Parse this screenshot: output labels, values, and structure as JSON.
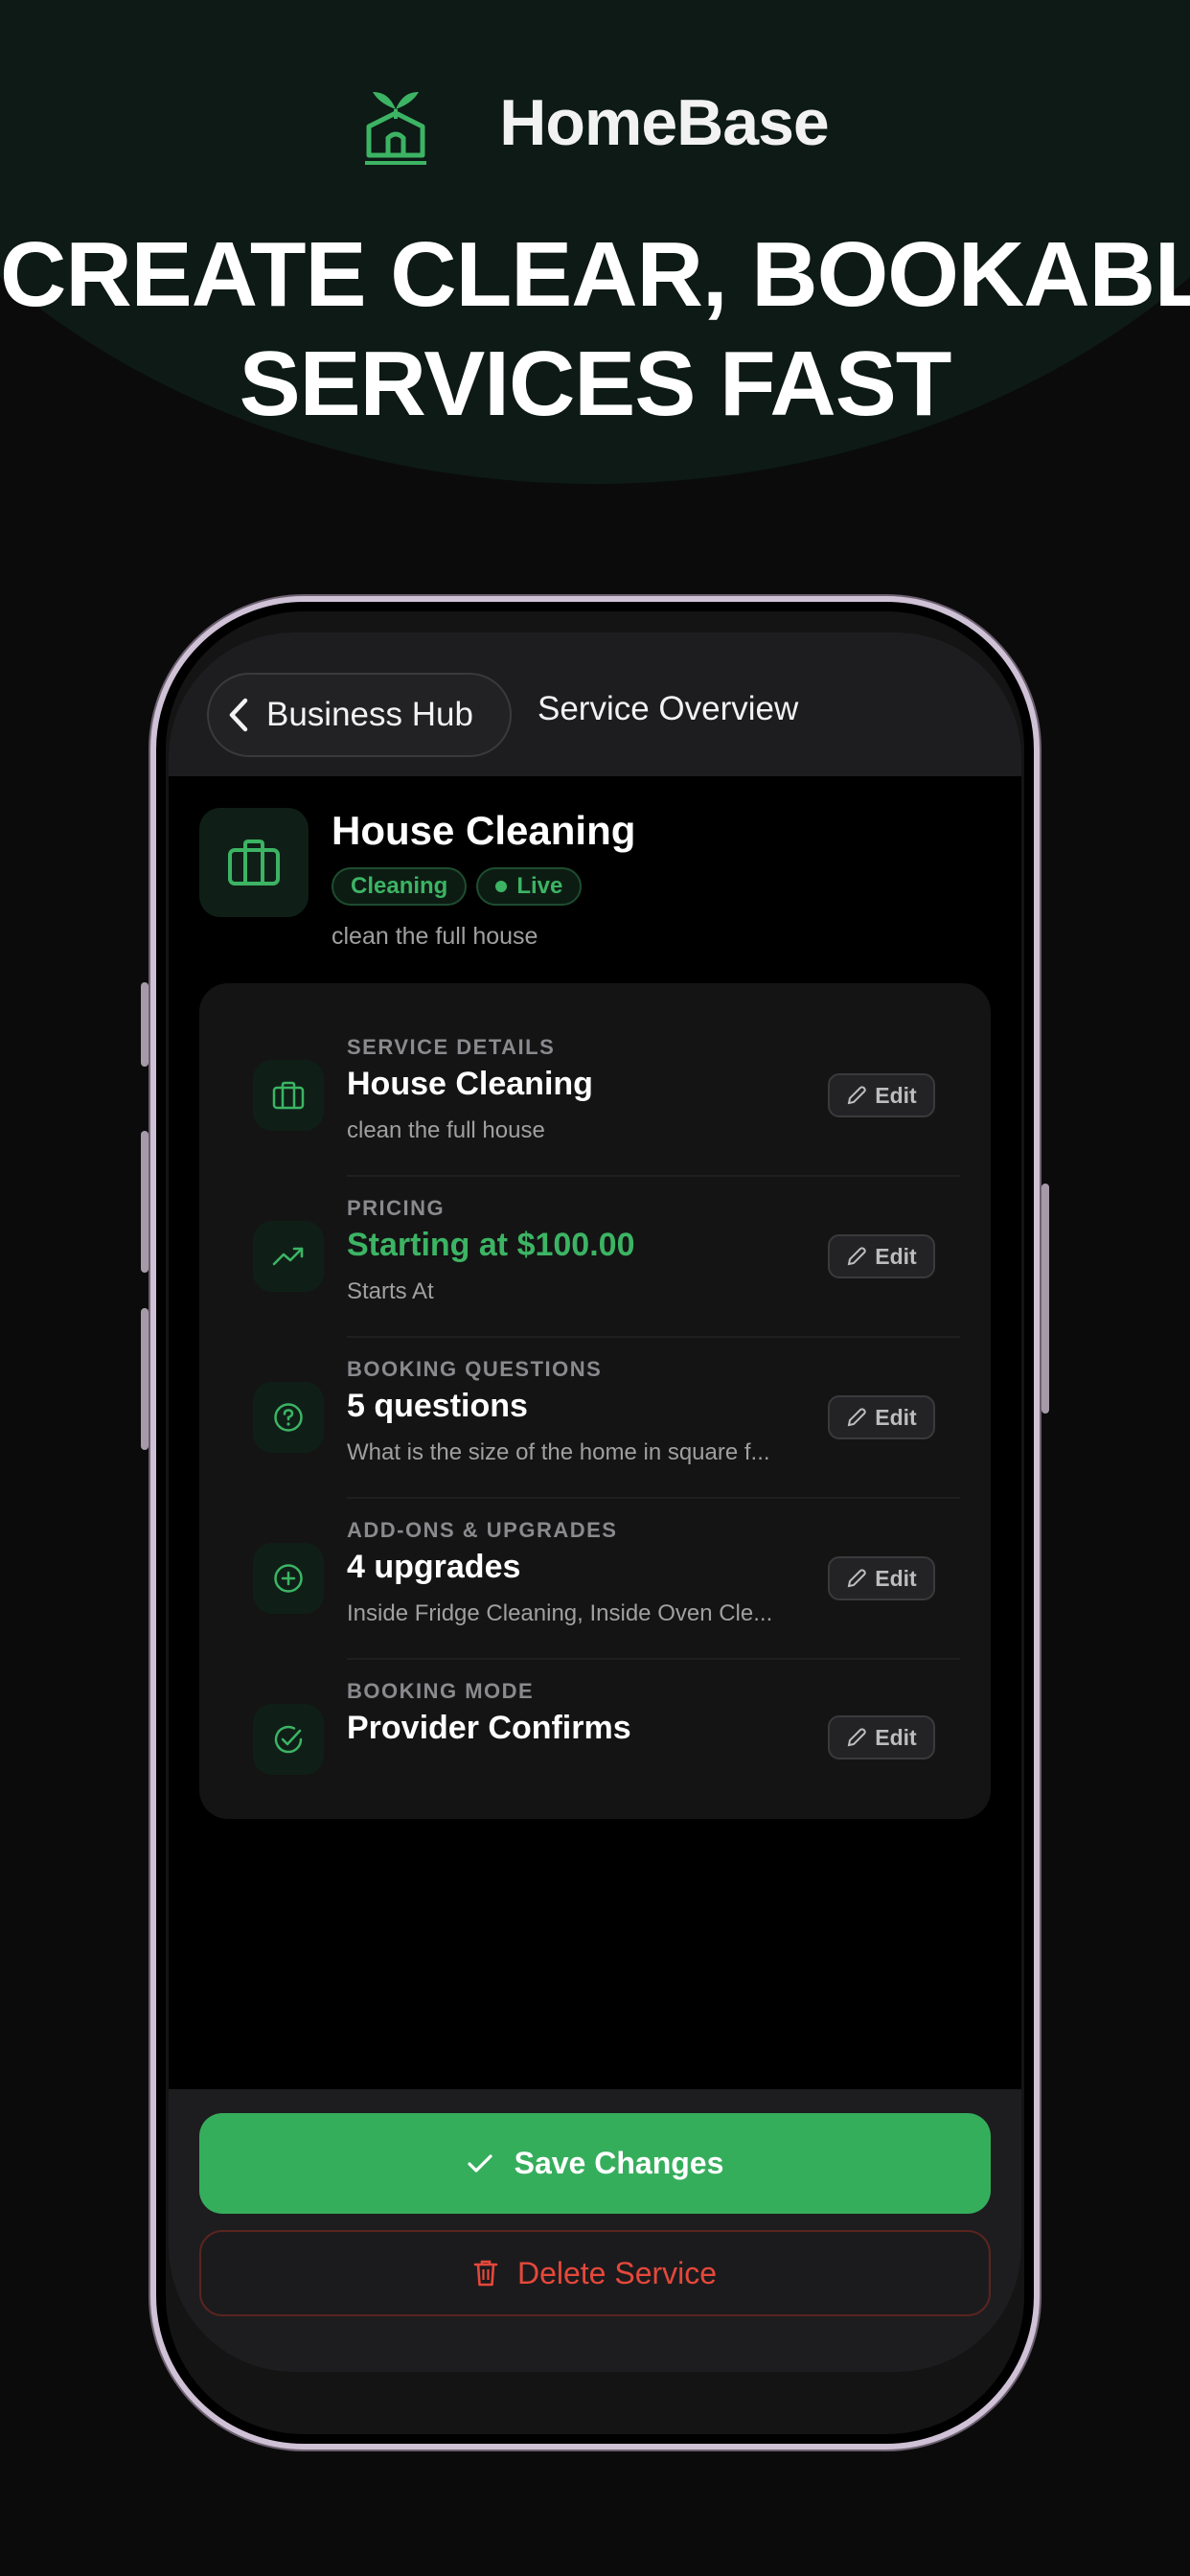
{
  "brand": {
    "name": "HomeBase",
    "logo": "house-sprout-logo"
  },
  "headline": {
    "line1": "CREATE CLEAR, BOOKABLE",
    "line2": "SERVICES FAST"
  },
  "nav": {
    "back_label": "Business Hub",
    "title": "Service Overview",
    "back_icon": "chevron-left-icon"
  },
  "service": {
    "title": "House Cleaning",
    "badges": [
      "Cleaning",
      "Live"
    ],
    "subtitle": "clean the full house",
    "icon": "briefcase-icon"
  },
  "sections": [
    {
      "eyebrow": "SERVICE DETAILS",
      "main": "House Cleaning",
      "sub": "clean the full house",
      "icon": "briefcase-icon",
      "edit": "Edit"
    },
    {
      "eyebrow": "PRICING",
      "main": "Starting at $100.00",
      "sub": "Starts At",
      "icon": "trending-up-icon",
      "edit": "Edit"
    },
    {
      "eyebrow": "BOOKING QUESTIONS",
      "main": "5 questions",
      "sub": "What is the size of the home in square f...",
      "icon": "help-circle-icon",
      "edit": "Edit"
    },
    {
      "eyebrow": "ADD-ONS & UPGRADES",
      "main": "4 upgrades",
      "sub": "Inside Fridge Cleaning, Inside Oven Cle...",
      "icon": "plus-circle-icon",
      "edit": "Edit"
    },
    {
      "eyebrow": "BOOKING MODE",
      "main": "Provider Confirms",
      "icon": "check-circle-icon",
      "edit": "Edit"
    }
  ],
  "actions": {
    "save": "Save Changes",
    "delete": "Delete Service"
  },
  "colors": {
    "accent": "#35ae5c",
    "danger": "#e5483b",
    "hero_bg": "#0d1a15"
  }
}
